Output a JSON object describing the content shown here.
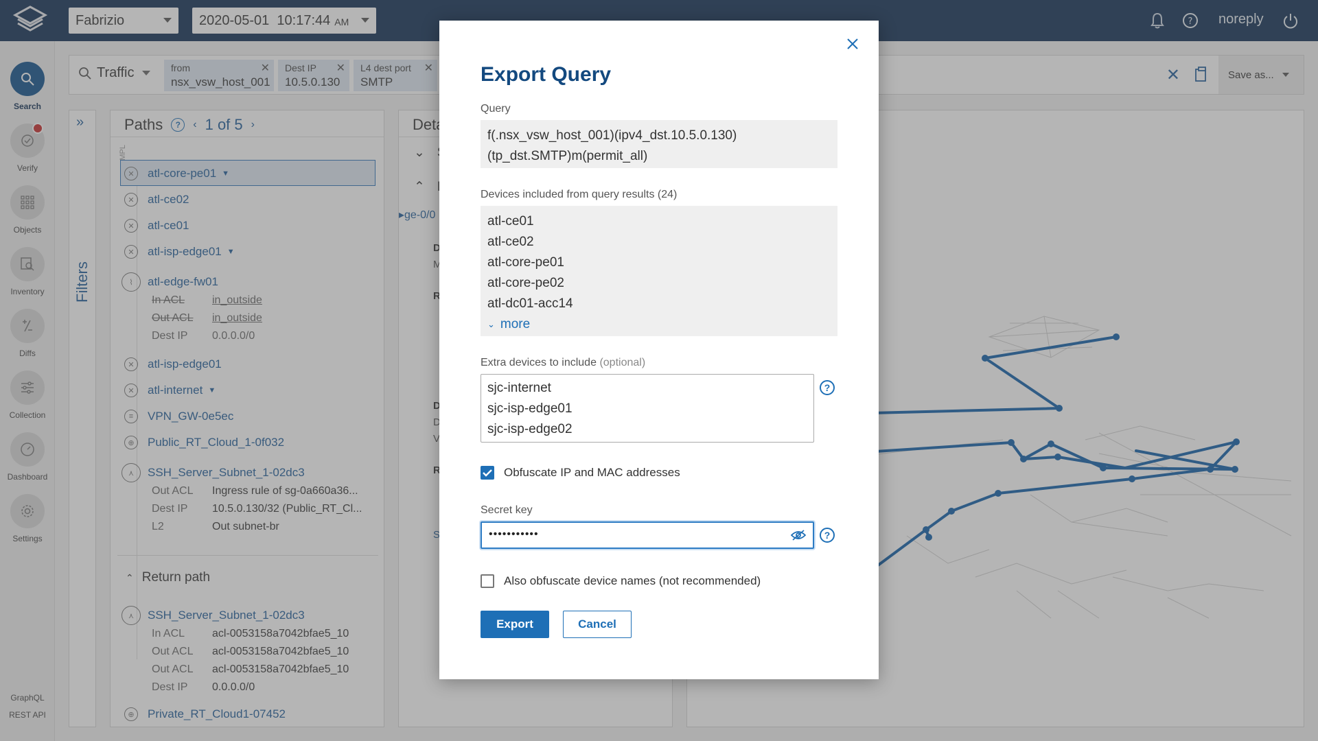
{
  "topbar": {
    "workspace": "Fabrizio",
    "datetime": "2020-05-01  10:17:44",
    "ampm": "AM",
    "user": "noreply"
  },
  "nav": {
    "items": [
      {
        "label": "Search"
      },
      {
        "label": "Verify"
      },
      {
        "label": "Objects"
      },
      {
        "label": "Inventory"
      },
      {
        "label": "Diffs"
      },
      {
        "label": "Collection"
      },
      {
        "label": "Dashboard"
      },
      {
        "label": "Settings"
      }
    ],
    "graphql": "GraphQL",
    "rest_api": "REST API"
  },
  "querybar": {
    "type": "Traffic",
    "chips": [
      {
        "key": "from",
        "value": "nsx_vsw_host_001"
      },
      {
        "key": "Dest IP",
        "value": "10.5.0.130"
      },
      {
        "key": "L4 dest port",
        "value": "SMTP"
      }
    ],
    "save_label": "Save as..."
  },
  "filters_label": "Filters",
  "paths": {
    "title": "Paths",
    "pager": "1 of 5",
    "mpls_label": "MPL",
    "hops": [
      {
        "name": "atl-core-pe01"
      },
      {
        "name": "atl-ce02"
      },
      {
        "name": "atl-ce01"
      },
      {
        "name": "atl-isp-edge01"
      },
      {
        "name": "atl-edge-fw01"
      },
      {
        "name": "atl-isp-edge01"
      },
      {
        "name": "atl-internet"
      },
      {
        "name": "VPN_GW-0e5ec"
      },
      {
        "name": "Public_RT_Cloud_1-0f032"
      },
      {
        "name": "SSH_Server_Subnet_1-02dc3"
      }
    ],
    "fw_details": [
      {
        "k": "In ACL",
        "v": "in_outside"
      },
      {
        "k": "Out ACL",
        "v": "in_outside"
      },
      {
        "k": "Dest IP",
        "v": "0.0.0.0/0"
      }
    ],
    "ssh_details": [
      {
        "k": "Out ACL",
        "v": "Ingress rule of sg-0a660a36..."
      },
      {
        "k": "Dest IP",
        "v": "10.5.0.130/32 (Public_RT_Cl..."
      },
      {
        "k": "L2",
        "v": "Out subnet-br"
      }
    ],
    "return_title": "Return path",
    "return_hop": "SSH_Server_Subnet_1-02dc3",
    "return_details": [
      {
        "k": "In ACL",
        "v": "acl-0053158a7042bfae5_10"
      },
      {
        "k": "Out ACL",
        "v": "acl-0053158a7042bfae5_10"
      },
      {
        "k": "Out ACL",
        "v": "acl-0053158a7042bfae5_10"
      },
      {
        "k": "Dest IP",
        "v": "0.0.0.0/0"
      }
    ],
    "return_last": "Private_RT_Cloud1-07452"
  },
  "details_panel": {
    "title": "Deta",
    "row1": "S",
    "row2": "L",
    "iface": "ge-0/0",
    "frag": [
      "D",
      "M",
      "R",
      "D",
      "D",
      "V",
      "R",
      "S"
    ]
  },
  "dialog": {
    "title": "Export Query",
    "query_label": "Query",
    "query_text": "f(.nsx_vsw_host_001)(ipv4_dst.10.5.0.130)(tp_dst.SMTP)m(permit_all)",
    "devices_label": "Devices included from query results (24)",
    "devices": [
      "atl-ce01",
      "atl-ce02",
      "atl-core-pe01",
      "atl-core-pe02",
      "atl-dc01-acc14"
    ],
    "more": "more",
    "extra_label": "Extra devices to include",
    "extra_optional": "(optional)",
    "extra_devices": [
      "sjc-internet",
      "sjc-isp-edge01",
      "sjc-isp-edge02"
    ],
    "obfuscate_label": "Obfuscate IP and MAC addresses",
    "obfuscate_checked": true,
    "secret_label": "Secret key",
    "secret_value": "•••••••••••",
    "obfuscate_names_label": "Also obfuscate device names (not recommended)",
    "obfuscate_names_checked": false,
    "export_label": "Export",
    "cancel_label": "Cancel"
  },
  "colors": {
    "topbar": "#0d2d52",
    "accent": "#1e6fb6",
    "title": "#13497f"
  }
}
